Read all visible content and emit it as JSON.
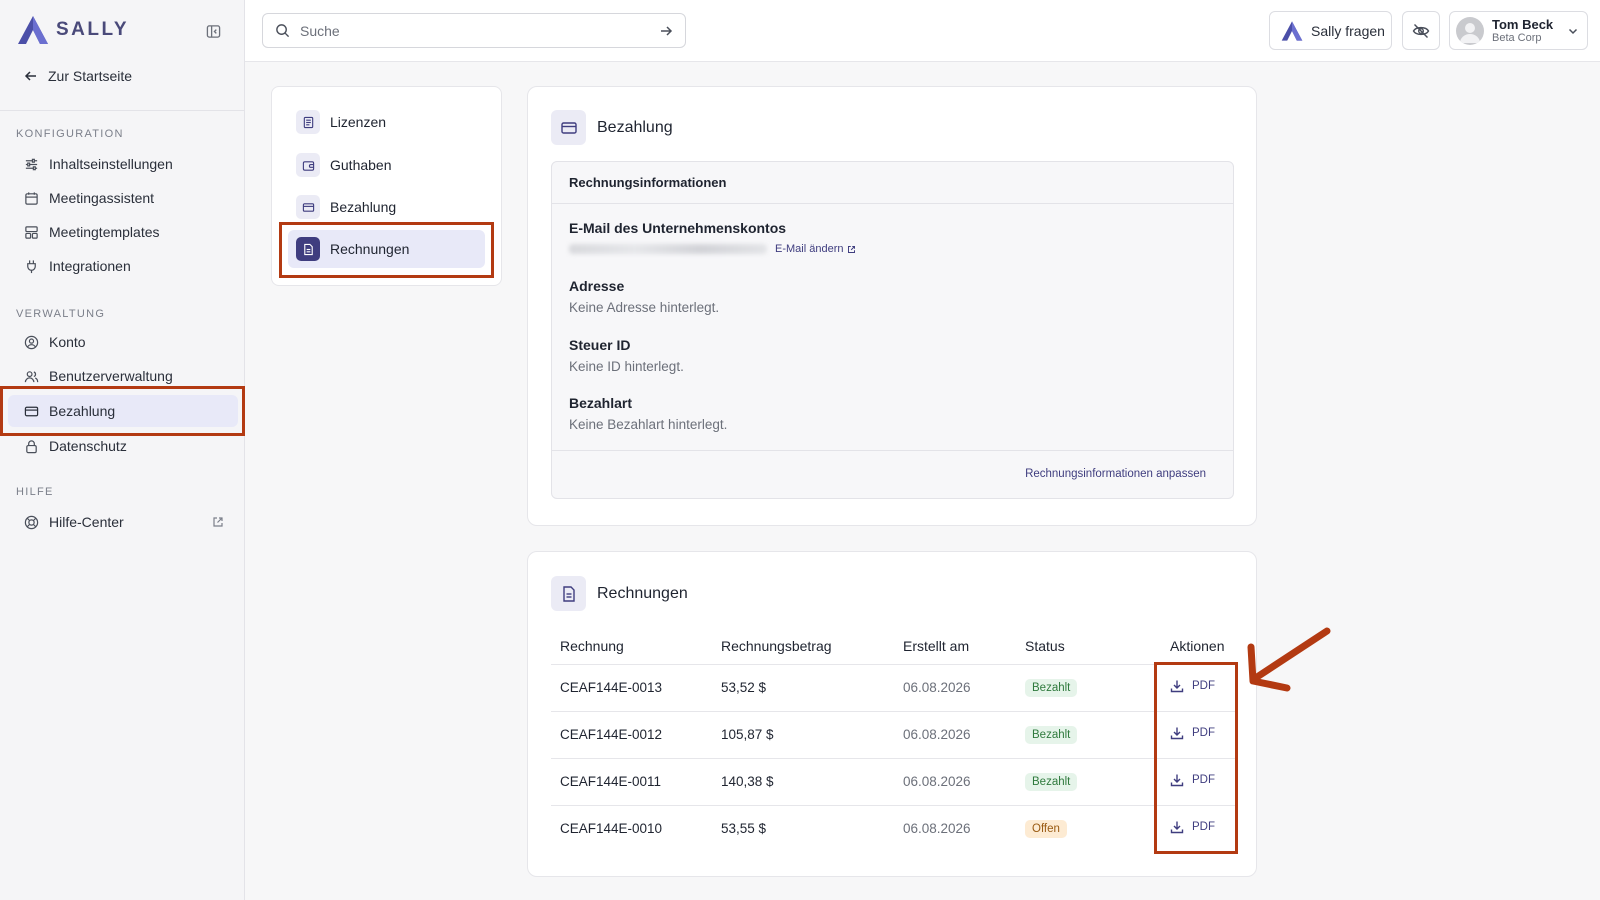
{
  "sidebar": {
    "logo_text": "SALLY",
    "back_link": "Zur Startseite",
    "sections": [
      {
        "label": "KONFIGURATION"
      },
      {
        "label": "VERWALTUNG"
      },
      {
        "label": "HILFE"
      }
    ],
    "items": [
      {
        "label": "Inhaltseinstellungen",
        "icon": "sliders-icon"
      },
      {
        "label": "Meetingassistent",
        "icon": "calendar-icon"
      },
      {
        "label": "Meetingtemplates",
        "icon": "template-icon"
      },
      {
        "label": "Integrationen",
        "icon": "plug-icon"
      },
      {
        "label": "Konto",
        "icon": "user-circle-icon"
      },
      {
        "label": "Benutzerverwaltung",
        "icon": "users-icon"
      },
      {
        "label": "Bezahlung",
        "icon": "credit-card-icon",
        "active": true
      },
      {
        "label": "Datenschutz",
        "icon": "lock-icon"
      },
      {
        "label": "Hilfe-Center",
        "icon": "lifebuoy-icon"
      }
    ]
  },
  "topbar": {
    "search_placeholder": "Suche",
    "ask_label": "Sally fragen",
    "user": {
      "name": "Tom Beck",
      "org": "Beta Corp"
    }
  },
  "subnav": {
    "items": [
      {
        "label": "Lizenzen",
        "icon": "document-icon"
      },
      {
        "label": "Guthaben",
        "icon": "wallet-icon"
      },
      {
        "label": "Bezahlung",
        "icon": "credit-card-icon"
      },
      {
        "label": "Rechnungen",
        "icon": "invoice-icon",
        "active": true
      }
    ]
  },
  "billing": {
    "title": "Bezahlung",
    "box_title": "Rechnungsinformationen",
    "email_label": "E-Mail des Unternehmenskontos",
    "email_change": "E-Mail ändern",
    "address_label": "Adresse",
    "address_value": "Keine Adresse hinterlegt.",
    "tax_label": "Steuer ID",
    "tax_value": "Keine ID hinterlegt.",
    "payment_label": "Bezahlart",
    "payment_value": "Keine Bezahlart hinterlegt.",
    "adjust_link": "Rechnungsinformationen anpassen"
  },
  "invoices": {
    "title": "Rechnungen",
    "columns": [
      "Rechnung",
      "Rechnungsbetrag",
      "Erstellt am",
      "Status",
      "Aktionen"
    ],
    "pdf_label": "PDF",
    "rows": [
      {
        "id": "CEAF144E-0013",
        "amount": "53,52 $",
        "date": "06.08.2026",
        "status": "Bezahlt",
        "status_type": "paid"
      },
      {
        "id": "CEAF144E-0012",
        "amount": "105,87 $",
        "date": "06.08.2026",
        "status": "Bezahlt",
        "status_type": "paid"
      },
      {
        "id": "CEAF144E-0011",
        "amount": "140,38 $",
        "date": "06.08.2026",
        "status": "Bezahlt",
        "status_type": "paid"
      },
      {
        "id": "CEAF144E-0010",
        "amount": "53,55 $",
        "date": "06.08.2026",
        "status": "Offen",
        "status_type": "open"
      }
    ]
  },
  "colors": {
    "accent": "#3f3d7f",
    "highlight": "#b33a12",
    "paid_bg": "#e6f4ea",
    "open_bg": "#fdebd3"
  }
}
